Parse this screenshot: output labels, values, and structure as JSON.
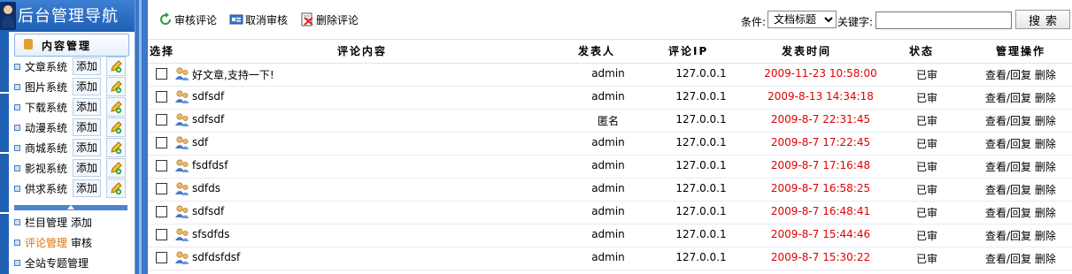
{
  "sidebar": {
    "title": "后台管理导航",
    "section": "内容管理",
    "systems": [
      {
        "name": "文章系统",
        "add": "添加"
      },
      {
        "name": "图片系统",
        "add": "添加"
      },
      {
        "name": "下载系统",
        "add": "添加"
      },
      {
        "name": "动漫系统",
        "add": "添加"
      },
      {
        "name": "商城系统",
        "add": "添加"
      },
      {
        "name": "影视系统",
        "add": "添加"
      },
      {
        "name": "供求系统",
        "add": "添加"
      }
    ],
    "lower": [
      {
        "name": "栏目管理",
        "action": "添加"
      },
      {
        "name": "评论管理",
        "action": "审核"
      },
      {
        "name": "全站专题管理",
        "action": ""
      }
    ]
  },
  "toolbar": {
    "approve_label": "审核评论",
    "cancel_label": "取消审核",
    "delete_label": "删除评论",
    "cond_label": "条件:",
    "cond_selected": "文档标题",
    "keyword_label": "关键字:",
    "keyword_value": "",
    "search_label": "搜索"
  },
  "table": {
    "headers": {
      "select": "选择",
      "content": "评论内容",
      "author": "发表人",
      "ip": "评论IP",
      "time": "发表时间",
      "status": "状态",
      "ops": "管理操作"
    },
    "rows": [
      {
        "content": "好文章,支持一下!",
        "author": "admin",
        "ip": "127.0.0.1",
        "time": "2009-11-23 10:58:00",
        "status": "已审",
        "view": "查看/回复",
        "del": "删除"
      },
      {
        "content": "sdfsdf",
        "author": "admin",
        "ip": "127.0.0.1",
        "time": "2009-8-13 14:34:18",
        "status": "已审",
        "view": "查看/回复",
        "del": "删除"
      },
      {
        "content": "sdfsdf",
        "author": "匿名",
        "ip": "127.0.0.1",
        "time": "2009-8-7 22:31:45",
        "status": "已审",
        "view": "查看/回复",
        "del": "删除"
      },
      {
        "content": "sdf",
        "author": "admin",
        "ip": "127.0.0.1",
        "time": "2009-8-7 17:22:45",
        "status": "已审",
        "view": "查看/回复",
        "del": "删除"
      },
      {
        "content": "fsdfdsf",
        "author": "admin",
        "ip": "127.0.0.1",
        "time": "2009-8-7 17:16:48",
        "status": "已审",
        "view": "查看/回复",
        "del": "删除"
      },
      {
        "content": "sdfds",
        "author": "admin",
        "ip": "127.0.0.1",
        "time": "2009-8-7 16:58:25",
        "status": "已审",
        "view": "查看/回复",
        "del": "删除"
      },
      {
        "content": "sdfsdf",
        "author": "admin",
        "ip": "127.0.0.1",
        "time": "2009-8-7 16:48:41",
        "status": "已审",
        "view": "查看/回复",
        "del": "删除"
      },
      {
        "content": "sfsdfds",
        "author": "admin",
        "ip": "127.0.0.1",
        "time": "2009-8-7 15:44:46",
        "status": "已审",
        "view": "查看/回复",
        "del": "删除"
      },
      {
        "content": "sdfdsfdsf",
        "author": "admin",
        "ip": "127.0.0.1",
        "time": "2009-8-7 15:30:22",
        "status": "已审",
        "view": "查看/回复",
        "del": "删除"
      }
    ]
  },
  "colors": {
    "accent": "#1f5fb4",
    "time_red": "#e00000",
    "active_link": "#e07000"
  }
}
